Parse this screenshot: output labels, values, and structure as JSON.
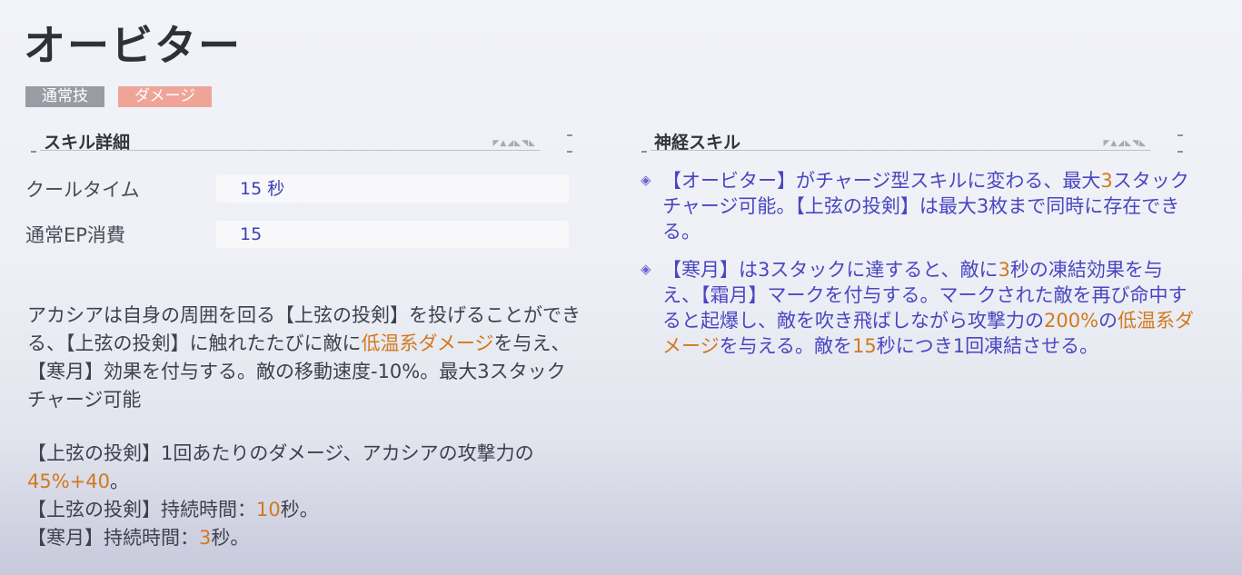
{
  "skill": {
    "name": "オービター",
    "tags": [
      "通常技",
      "ダメージ"
    ]
  },
  "details": {
    "heading": "スキル詳細",
    "cooldown_label": "クールタイム",
    "cooldown_value": "15 秒",
    "ep_label": "通常EP消費",
    "ep_value": "15"
  },
  "description": {
    "p1_a": "アカシアは自身の周囲を回る【上弦の投剣】を投げることができる、【上弦の投剣】に触れたたびに敵に",
    "p1_hl": "低温系ダメージ",
    "p1_b": "を与え、【寒月】効果を付与する。敵の移動速度-10%。最大3スタックチャージ可能",
    "p2_a": "【上弦の投剣】1回あたりのダメージ、アカシアの攻撃力の",
    "p2_hl": "45%+40",
    "p2_b": "。",
    "p3_a": "【上弦の投剣】持続時間：",
    "p3_hl": "10",
    "p3_b": "秒。",
    "p4_a": "【寒月】持続時間：",
    "p4_hl": "3",
    "p4_b": "秒。"
  },
  "neural": {
    "heading": "神経スキル",
    "b1_a": "【オービター】がチャージ型スキルに変わる、最大",
    "b1_hl": "3",
    "b1_b": "スタックチャージ可能。【上弦の投剣】は最大3枚まで同時に存在できる。",
    "b2_a": "【寒月】は3スタックに達すると、敵に",
    "b2_hl1": "3",
    "b2_b": "秒の凍結効果を与え、【霜月】マークを付与する。マークされた敵を再び命中すると起爆し、敵を吹き飛ばしながら攻撃力の",
    "b2_hl2": "200%",
    "b2_c": "の",
    "b2_hl3": "低温系ダメージ",
    "b2_d": "を与える。敵を",
    "b2_hl4": "15",
    "b2_e": "秒につき1回凍結させる。"
  },
  "colors": {
    "highlight": "#d07a1e",
    "neural_text": "#4a46c2",
    "tag_gray": "#9a9ca5",
    "tag_pink": "#eea598"
  }
}
